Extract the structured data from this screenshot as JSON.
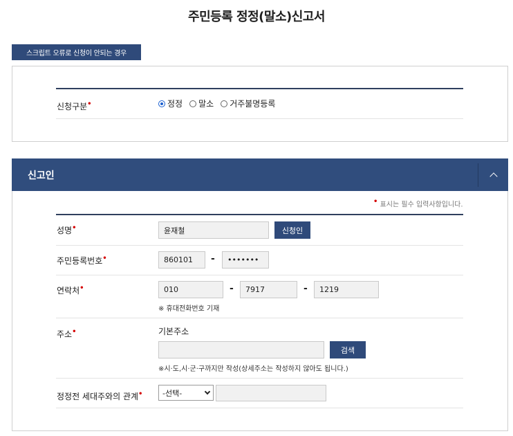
{
  "page": {
    "title": "주민등록 정정(말소)신고서"
  },
  "script_error_button": "스크립트 오류로 신청이 안되는 경우",
  "application_type": {
    "label": "신청구분",
    "options": [
      {
        "label": "정정",
        "checked": true
      },
      {
        "label": "말소",
        "checked": false
      },
      {
        "label": "거주불명등록",
        "checked": false
      }
    ]
  },
  "reporter": {
    "section_title": "신고인",
    "required_note": "표시는 필수 입력사항입니다.",
    "name": {
      "label": "성명",
      "value": "윤재철",
      "button": "신청인"
    },
    "resident_number": {
      "label": "주민등록번호",
      "front": "860101",
      "back": "•••••••"
    },
    "contact": {
      "label": "연락처",
      "part1": "010",
      "part2": "7917",
      "part3": "1219",
      "hint": "※ 휴대전화번호 기재"
    },
    "address": {
      "label": "주소",
      "sub_label": "기본주소",
      "value": "",
      "search_button": "검색",
      "hint": "※시·도,시·군·구까지만 작성(상세주소는 작성하지 않아도 됩니다.)"
    },
    "relation": {
      "label": "정정전 세대주와의 관계",
      "select_value": "-선택-",
      "input_value": ""
    }
  },
  "colors": {
    "navy": "#304d7d",
    "button_navy": "#2f4a7a",
    "required_red": "#d50000",
    "radio_blue": "#1a5fd0"
  },
  "icons": {
    "collapse": "chevron-up-icon"
  }
}
